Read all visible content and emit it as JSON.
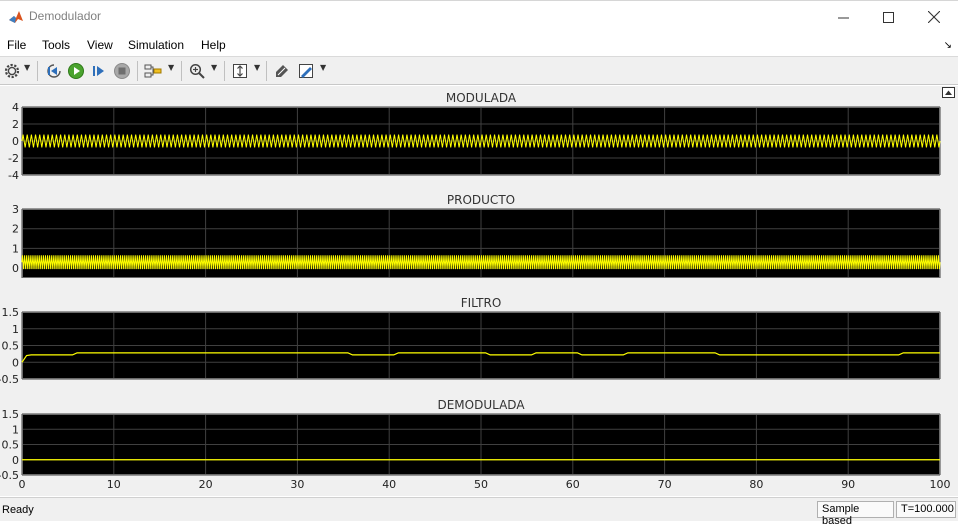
{
  "window": {
    "title": "Demodulador"
  },
  "menu": [
    "File",
    "Tools",
    "View",
    "Simulation",
    "Help"
  ],
  "toolbar": {
    "icons": [
      "gear-icon",
      "step-back-icon",
      "run-icon",
      "step-forward-icon",
      "stop-icon",
      "highlight-icon",
      "zoom-icon",
      "scale-axes-icon",
      "cursor-icon",
      "style-icon"
    ]
  },
  "status": {
    "ready": "Ready",
    "mode": "Sample based",
    "time": "T=100.000"
  },
  "colors": {
    "plot_bg": "#000000",
    "trace": "#ffff00",
    "grid": "#404040",
    "frame": "#f0f0f0"
  },
  "chart_data": [
    {
      "type": "line",
      "title": "MODULADA",
      "x_range": [
        0,
        100
      ],
      "ylim": [
        -4,
        4
      ],
      "yticks": [
        -4,
        -2,
        0,
        2,
        4
      ],
      "grid": true,
      "signal": "oscillation",
      "amplitude": 0.75,
      "offset": 0,
      "cycles": 220,
      "x": [
        0,
        100
      ],
      "y": [
        0,
        0
      ]
    },
    {
      "type": "line",
      "title": "PRODUCTO",
      "x_range": [
        0,
        100
      ],
      "ylim": [
        -0.5,
        3
      ],
      "yticks": [
        0,
        1,
        2,
        3
      ],
      "grid": true,
      "signal": "oscillation",
      "amplitude": 0.35,
      "offset": 0.3,
      "cycles": 440,
      "x": [
        0,
        100
      ],
      "y": [
        0.3,
        0.3
      ]
    },
    {
      "type": "line",
      "title": "FILTRO",
      "x_range": [
        0,
        100
      ],
      "ylim": [
        -0.5,
        1.5
      ],
      "yticks": [
        -0.5,
        0,
        0.5,
        1,
        1.5
      ],
      "grid": true,
      "signal": "step",
      "x": [
        0,
        0.5,
        1,
        5.5,
        6,
        35.5,
        36,
        40.5,
        41,
        50.5,
        51,
        55.5,
        56,
        60.5,
        61,
        65.5,
        66,
        75.5,
        76,
        95.5,
        96,
        100
      ],
      "y": [
        0,
        0.2,
        0.22,
        0.22,
        0.28,
        0.28,
        0.22,
        0.22,
        0.28,
        0.28,
        0.22,
        0.22,
        0.28,
        0.28,
        0.22,
        0.22,
        0.28,
        0.28,
        0.22,
        0.22,
        0.28,
        0.28
      ]
    },
    {
      "type": "line",
      "title": "DEMODULADA",
      "x_range": [
        0,
        100
      ],
      "ylim": [
        -0.5,
        1.5
      ],
      "yticks": [
        -0.5,
        0,
        0.5,
        1,
        1.5
      ],
      "xticks": [
        0,
        10,
        20,
        30,
        40,
        50,
        60,
        70,
        80,
        90,
        100
      ],
      "grid": true,
      "signal": "step",
      "x": [
        0,
        100
      ],
      "y": [
        0,
        0
      ]
    }
  ]
}
